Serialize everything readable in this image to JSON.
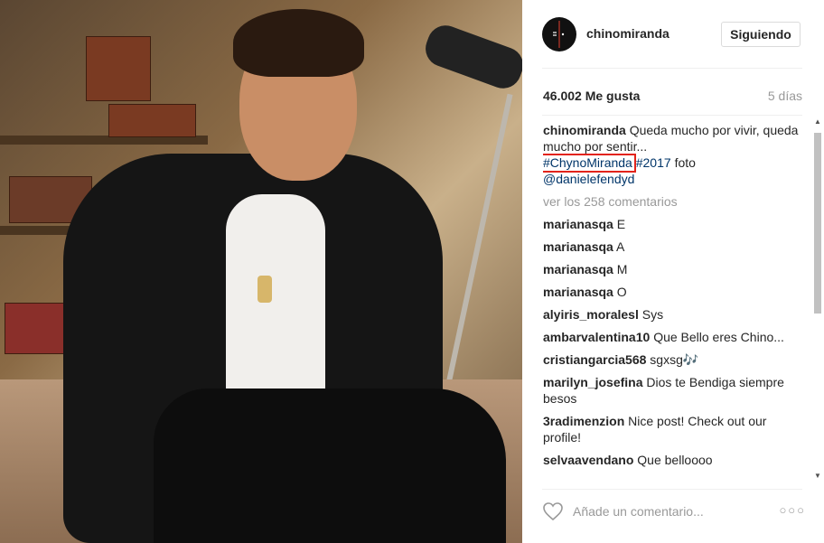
{
  "post": {
    "username": "chinomiranda",
    "follow_label": "Siguiendo",
    "likes": "46.002 Me gusta",
    "age": "5 días",
    "caption": {
      "user": "chinomiranda",
      "text": "Queda mucho por vivir, queda mucho por sentir...",
      "hashtag_highlight": "#ChynoMiranda",
      "hashtag2": "#2017",
      "word": "foto",
      "mention": "@danielefendyd"
    },
    "view_all": "ver los 258 comentarios",
    "comments": [
      {
        "user": "marianasqa",
        "text": "E"
      },
      {
        "user": "marianasqa",
        "text": "A"
      },
      {
        "user": "marianasqa",
        "text": "M"
      },
      {
        "user": "marianasqa",
        "text": "O"
      },
      {
        "user": "alyiris_moralesl",
        "text": "Sys"
      },
      {
        "user": "ambarvalentina10",
        "text": "Que Bello eres Chino..."
      },
      {
        "user": "cristiangarcia568",
        "text": "sgxsg🎶"
      },
      {
        "user": "marilyn_josefina",
        "text": "Dios te Bendiga siempre besos"
      },
      {
        "user": "3radimenzion",
        "text": "Nice post! Check out our profile!"
      },
      {
        "user": "selvaavendano",
        "text": "Que belloooo"
      }
    ],
    "add_comment_placeholder": "Añade un comentario...",
    "more_icon": "ellipsis-icon"
  },
  "colors": {
    "highlight_box": "#e2231a",
    "link": "#003569",
    "muted": "#999999"
  }
}
